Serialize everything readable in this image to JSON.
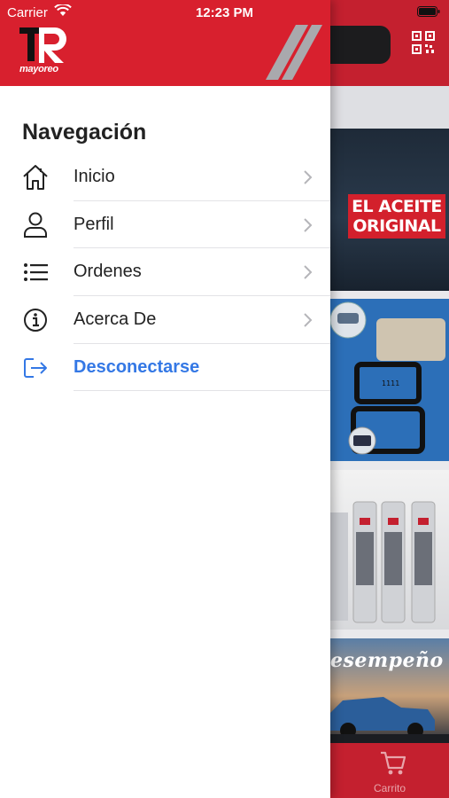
{
  "status_bar": {
    "carrier": "Carrier",
    "time": "12:23 PM"
  },
  "drawer": {
    "logo_text": "mayoreo",
    "nav_title": "Navegación",
    "items": [
      {
        "label": "Inicio",
        "icon": "home-icon"
      },
      {
        "label": "Perfil",
        "icon": "person-icon"
      },
      {
        "label": "Ordenes",
        "icon": "list-icon"
      },
      {
        "label": "Acerca De",
        "icon": "info-icon"
      },
      {
        "label": "Desconectarse",
        "icon": "logout-icon"
      }
    ]
  },
  "background": {
    "banner_oil_lines": [
      "EL ACEITE",
      "ORIGINAL"
    ],
    "banner_car_text": "esempeño",
    "tab_cart_label": "Carrito"
  },
  "colors": {
    "brand_red": "#d8202e",
    "link_blue": "#3478e5"
  }
}
